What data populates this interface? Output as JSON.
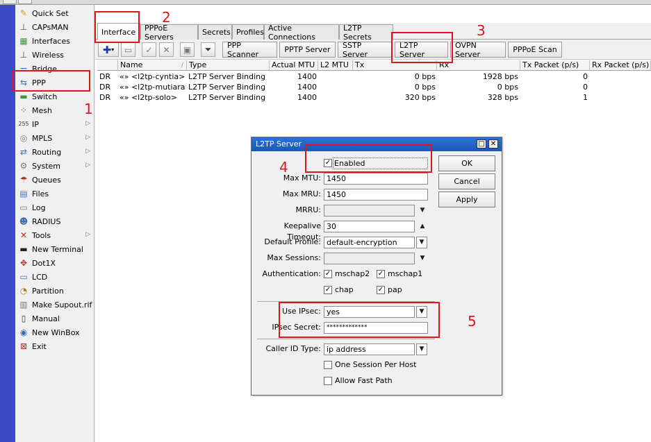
{
  "sidebar": {
    "items": [
      {
        "label": "Quick Set",
        "icon": "wand-icon",
        "color": "#d39b22"
      },
      {
        "label": "CAPsMAN",
        "icon": "antenna-icon",
        "color": "#555555"
      },
      {
        "label": "Interfaces",
        "icon": "interfaces-icon",
        "color": "#3a9a3a"
      },
      {
        "label": "Wireless",
        "icon": "wireless-icon",
        "color": "#555555"
      },
      {
        "label": "Bridge",
        "icon": "bridge-icon",
        "color": "#4169c8"
      },
      {
        "label": "PPP",
        "icon": "ppp-icon",
        "color": "#4169c8"
      },
      {
        "label": "Switch",
        "icon": "switch-icon",
        "color": "#3a9a3a"
      },
      {
        "label": "Mesh",
        "icon": "mesh-icon",
        "color": "#4169c8"
      },
      {
        "label": "IP",
        "icon": "ip-icon",
        "color": "#333333",
        "has_arrow": true
      },
      {
        "label": "MPLS",
        "icon": "mpls-icon",
        "color": "#777777",
        "has_arrow": true
      },
      {
        "label": "Routing",
        "icon": "routing-icon",
        "color": "#4169c8",
        "has_arrow": true
      },
      {
        "label": "System",
        "icon": "gear-icon",
        "color": "#777777",
        "has_arrow": true
      },
      {
        "label": "Queues",
        "icon": "queues-icon",
        "color": "#b03030"
      },
      {
        "label": "Files",
        "icon": "folder-icon",
        "color": "#3a7ad0"
      },
      {
        "label": "Log",
        "icon": "log-icon",
        "color": "#777777"
      },
      {
        "label": "RADIUS",
        "icon": "radius-icon",
        "color": "#3a6ab0"
      },
      {
        "label": "Tools",
        "icon": "tools-icon",
        "color": "#b03030",
        "has_arrow": true
      },
      {
        "label": "New Terminal",
        "icon": "terminal-icon",
        "color": "#222222"
      },
      {
        "label": "Dot1X",
        "icon": "dot1x-icon",
        "color": "#b03030"
      },
      {
        "label": "LCD",
        "icon": "lcd-icon",
        "color": "#3a7ad0"
      },
      {
        "label": "Partition",
        "icon": "partition-icon",
        "color": "#b07a20"
      },
      {
        "label": "Make Supout.rif",
        "icon": "supout-icon",
        "color": "#777777"
      },
      {
        "label": "Manual",
        "icon": "manual-icon",
        "color": "#333333"
      },
      {
        "label": "New WinBox",
        "icon": "winbox-icon",
        "color": "#3a6ab0"
      },
      {
        "label": "Exit",
        "icon": "exit-icon",
        "color": "#b03030"
      }
    ]
  },
  "tabs": [
    "Interface",
    "PPPoE Servers",
    "Secrets",
    "Profiles",
    "Active Connections",
    "L2TP Secrets"
  ],
  "toolbar": {
    "buttons": [
      "PPP Scanner",
      "PPTP Server",
      "SSTP Server",
      "L2TP Server",
      "OVPN Server",
      "PPPoE Scan"
    ]
  },
  "table": {
    "columns": [
      "Name",
      "Type",
      "Actual MTU",
      "L2 MTU",
      "Tx",
      "Rx",
      "Tx Packet (p/s)",
      "Rx Packet (p/s)"
    ],
    "rows": [
      {
        "flags": "DR",
        "name": "«» <l2tp-cyntia>",
        "type": "L2TP Server Binding",
        "mtu": "1400",
        "l2mtu": "",
        "tx": "0 bps",
        "rx": "1928 bps",
        "txp": "0",
        "rxp": ""
      },
      {
        "flags": "DR",
        "name": "«» <l2tp-mutiara>",
        "type": "L2TP Server Binding",
        "mtu": "1400",
        "l2mtu": "",
        "tx": "0 bps",
        "rx": "0 bps",
        "txp": "0",
        "rxp": ""
      },
      {
        "flags": "DR",
        "name": "«» <l2tp-solo>",
        "type": "L2TP Server Binding",
        "mtu": "1400",
        "l2mtu": "",
        "tx": "320 bps",
        "rx": "328 bps",
        "txp": "1",
        "rxp": ""
      }
    ]
  },
  "dialog": {
    "title": "L2TP Server",
    "enabled_label": "Enabled",
    "enabled": true,
    "fields": {
      "max_mtu": {
        "label": "Max MTU:",
        "value": "1450"
      },
      "max_mru": {
        "label": "Max MRU:",
        "value": "1450"
      },
      "mrru": {
        "label": "MRRU:",
        "value": ""
      },
      "keepalive": {
        "label": "Keepalive Timeout:",
        "value": "30"
      },
      "default_profile": {
        "label": "Default Profile:",
        "value": "default-encryption"
      },
      "max_sessions": {
        "label": "Max Sessions:",
        "value": ""
      },
      "use_ipsec": {
        "label": "Use IPsec:",
        "value": "yes"
      },
      "ipsec_secret": {
        "label": "IPsec Secret:",
        "value": "*************"
      },
      "caller_id": {
        "label": "Caller ID Type:",
        "value": "ip address"
      }
    },
    "auth_label": "Authentication:",
    "auth": [
      {
        "label": "mschap2",
        "checked": true
      },
      {
        "label": "mschap1",
        "checked": true
      },
      {
        "label": "chap",
        "checked": true
      },
      {
        "label": "pap",
        "checked": true
      }
    ],
    "one_session": {
      "label": "One Session Per Host",
      "checked": false
    },
    "allow_fast_path": {
      "label": "Allow Fast Path",
      "checked": false
    },
    "buttons": {
      "ok": "OK",
      "cancel": "Cancel",
      "apply": "Apply"
    }
  },
  "annotations": {
    "n1": "1",
    "n2": "2",
    "n3": "3",
    "n4": "4",
    "n5": "5",
    "color": "#e0141e"
  },
  "colors": {
    "accent_strip": "#3b49c2",
    "titlebar": "#1a58b6"
  }
}
